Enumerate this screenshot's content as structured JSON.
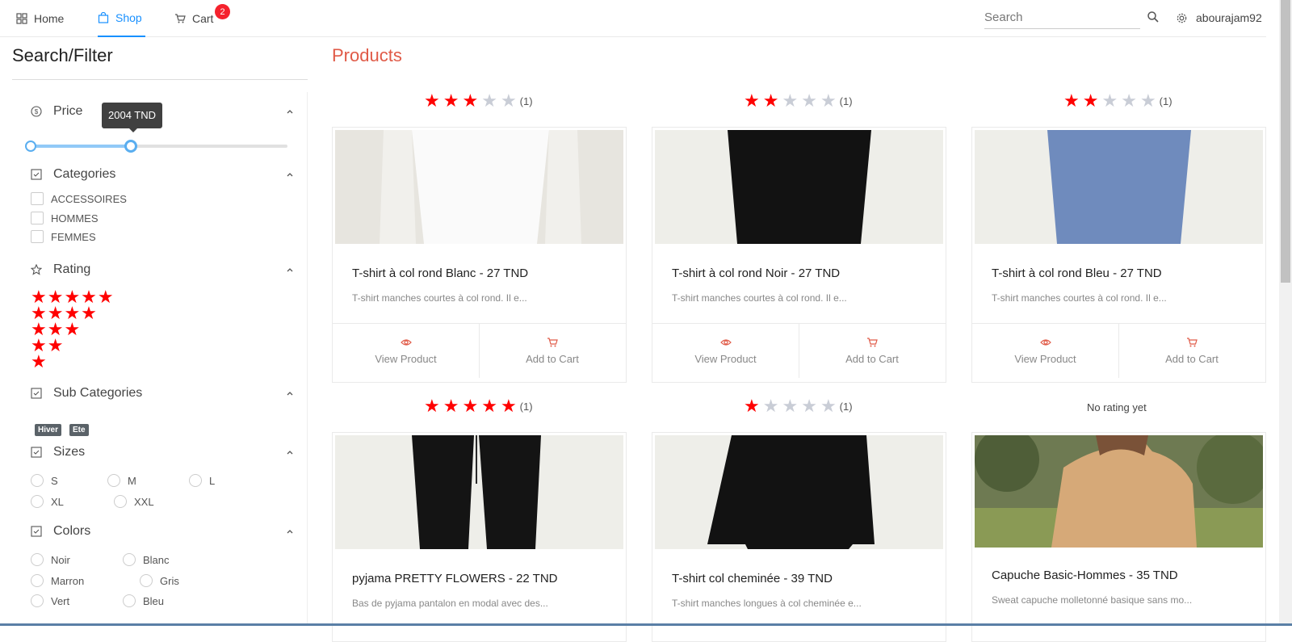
{
  "nav": {
    "home": "Home",
    "shop": "Shop",
    "cart": "Cart",
    "cart_count": "2",
    "search_placeholder": "Search",
    "username": "abourajam92"
  },
  "sidebar": {
    "title": "Search/Filter",
    "price": {
      "label": "Price",
      "tooltip": "2004 TND",
      "slider_fraction": 0.39
    },
    "categories": {
      "label": "Categories",
      "items": [
        "ACCESSOIRES",
        "HOMMES",
        "FEMMES"
      ]
    },
    "rating": {
      "label": "Rating",
      "rows": [
        "★★★★★",
        "★★★★",
        "★★★",
        "★★",
        "★"
      ]
    },
    "subcategories": {
      "label": "Sub Categories",
      "tags": [
        "Hiver",
        "Ete"
      ]
    },
    "sizes": {
      "label": "Sizes",
      "items": [
        "S",
        "M",
        "L",
        "XL",
        "XXL"
      ]
    },
    "colors": {
      "label": "Colors",
      "items": [
        "Noir",
        "Blanc",
        "Marron",
        "Gris",
        "Vert",
        "Bleu"
      ]
    }
  },
  "main": {
    "title": "Products",
    "actions": {
      "view": "View Product",
      "add": "Add to Cart"
    },
    "products": [
      {
        "rating": 3,
        "count": "(1)",
        "title": "T-shirt à col rond Blanc - 27 TND",
        "desc": "T-shirt manches courtes à col rond. Il e...",
        "image": "white-tshirt"
      },
      {
        "rating": 2,
        "count": "(1)",
        "title": "T-shirt à col rond Noir - 27 TND",
        "desc": "T-shirt manches courtes à col rond. Il e...",
        "image": "black-tshirt"
      },
      {
        "rating": 2,
        "count": "(1)",
        "title": "T-shirt à col rond Bleu - 27 TND",
        "desc": "T-shirt manches courtes à col rond. Il e...",
        "image": "blue-tshirt"
      },
      {
        "rating": 5,
        "count": "(1)",
        "title": "pyjama PRETTY FLOWERS - 22 TND",
        "desc": "Bas de pyjama pantalon en modal avec des...",
        "image": "black-pants"
      },
      {
        "rating": 1,
        "count": "(1)",
        "title": "T-shirt col cheminée - 39 TND",
        "desc": "T-shirt manches longues à col cheminée e...",
        "image": "black-longsleeve"
      },
      {
        "rating": null,
        "no_rating": "No rating yet",
        "title": "Capuche Basic-Hommes - 35 TND",
        "desc": "Sweat capuche molletonné basique sans mo...",
        "image": "beige-hoodie"
      }
    ]
  },
  "colors": {
    "accent": "#1890ff",
    "title": "#e05a47",
    "star": "#ff0000"
  }
}
